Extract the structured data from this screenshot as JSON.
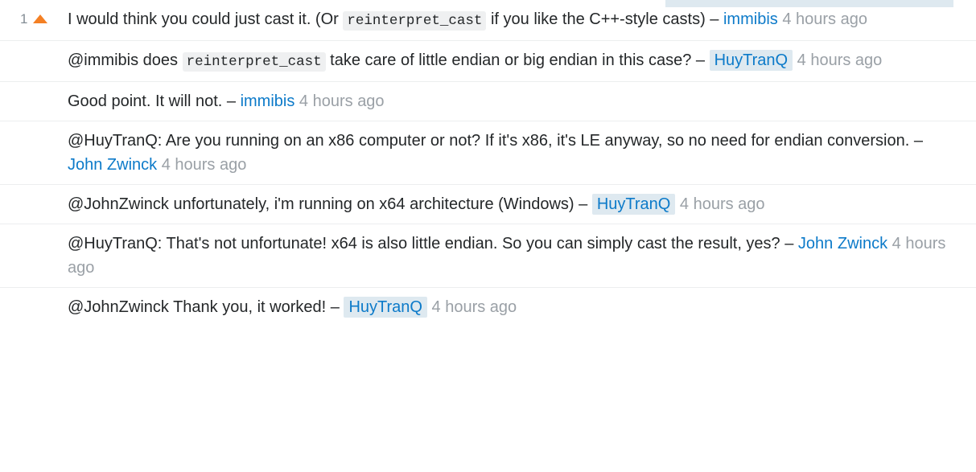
{
  "page": {
    "top_bar": {
      "name": "truncated-highlight-bar",
      "color": "#dee9f0"
    },
    "colors": {
      "link": "#0c7ac9",
      "owner_highlight": "#dee9f0",
      "code_background": "#eff0f1",
      "upvote_arrow": "#f48024",
      "timestamp": "#9aa0a6",
      "divider": "#eceeef",
      "text": "#242729"
    }
  },
  "comments": [
    {
      "id": "comment-1",
      "score": "1",
      "has_vote_arrow": true,
      "segments": [
        {
          "type": "text",
          "value": "I would think you could just cast it. (Or "
        },
        {
          "type": "code",
          "value": "reinterpret_cast"
        },
        {
          "type": "text",
          "value": " if you like the C++-style casts) "
        }
      ],
      "dash": "–",
      "author": "immibis",
      "author_is_owner": false,
      "timestamp": "4 hours ago"
    },
    {
      "id": "comment-2",
      "score": "",
      "has_vote_arrow": false,
      "segments": [
        {
          "type": "text",
          "value": "@immibis does "
        },
        {
          "type": "code",
          "value": "reinterpret_cast"
        },
        {
          "type": "text",
          "value": " take care of little endian or big endian in this case? "
        }
      ],
      "dash": "–",
      "author": "HuyTranQ",
      "author_is_owner": true,
      "timestamp": "4 hours ago"
    },
    {
      "id": "comment-3",
      "score": "",
      "has_vote_arrow": false,
      "segments": [
        {
          "type": "text",
          "value": "Good point. It will not. "
        }
      ],
      "dash": "–",
      "author": "immibis",
      "author_is_owner": false,
      "timestamp": "4 hours ago"
    },
    {
      "id": "comment-4",
      "score": "",
      "has_vote_arrow": false,
      "segments": [
        {
          "type": "text",
          "value": "@HuyTranQ: Are you running on an x86 computer or not? If it's x86, it's LE anyway, so no need for endian conversion. "
        }
      ],
      "dash": "–",
      "author": "John Zwinck",
      "author_is_owner": false,
      "timestamp": "4 hours ago"
    },
    {
      "id": "comment-5",
      "score": "",
      "has_vote_arrow": false,
      "segments": [
        {
          "type": "text",
          "value": "@JohnZwinck unfortunately, i'm running on x64 architecture (Windows) "
        }
      ],
      "dash": "–",
      "author": "HuyTranQ",
      "author_is_owner": true,
      "timestamp": "4 hours ago"
    },
    {
      "id": "comment-6",
      "score": "",
      "has_vote_arrow": false,
      "segments": [
        {
          "type": "text",
          "value": "@HuyTranQ: That's not unfortunate! x64 is also little endian. So you can simply cast the result, yes? "
        }
      ],
      "dash": "–",
      "author": "John Zwinck",
      "author_is_owner": false,
      "timestamp": "4 hours ago"
    },
    {
      "id": "comment-7",
      "score": "",
      "has_vote_arrow": false,
      "segments": [
        {
          "type": "text",
          "value": "@JohnZwinck Thank you, it worked! "
        }
      ],
      "dash": "–",
      "author": "HuyTranQ",
      "author_is_owner": true,
      "timestamp": "4 hours ago"
    }
  ]
}
